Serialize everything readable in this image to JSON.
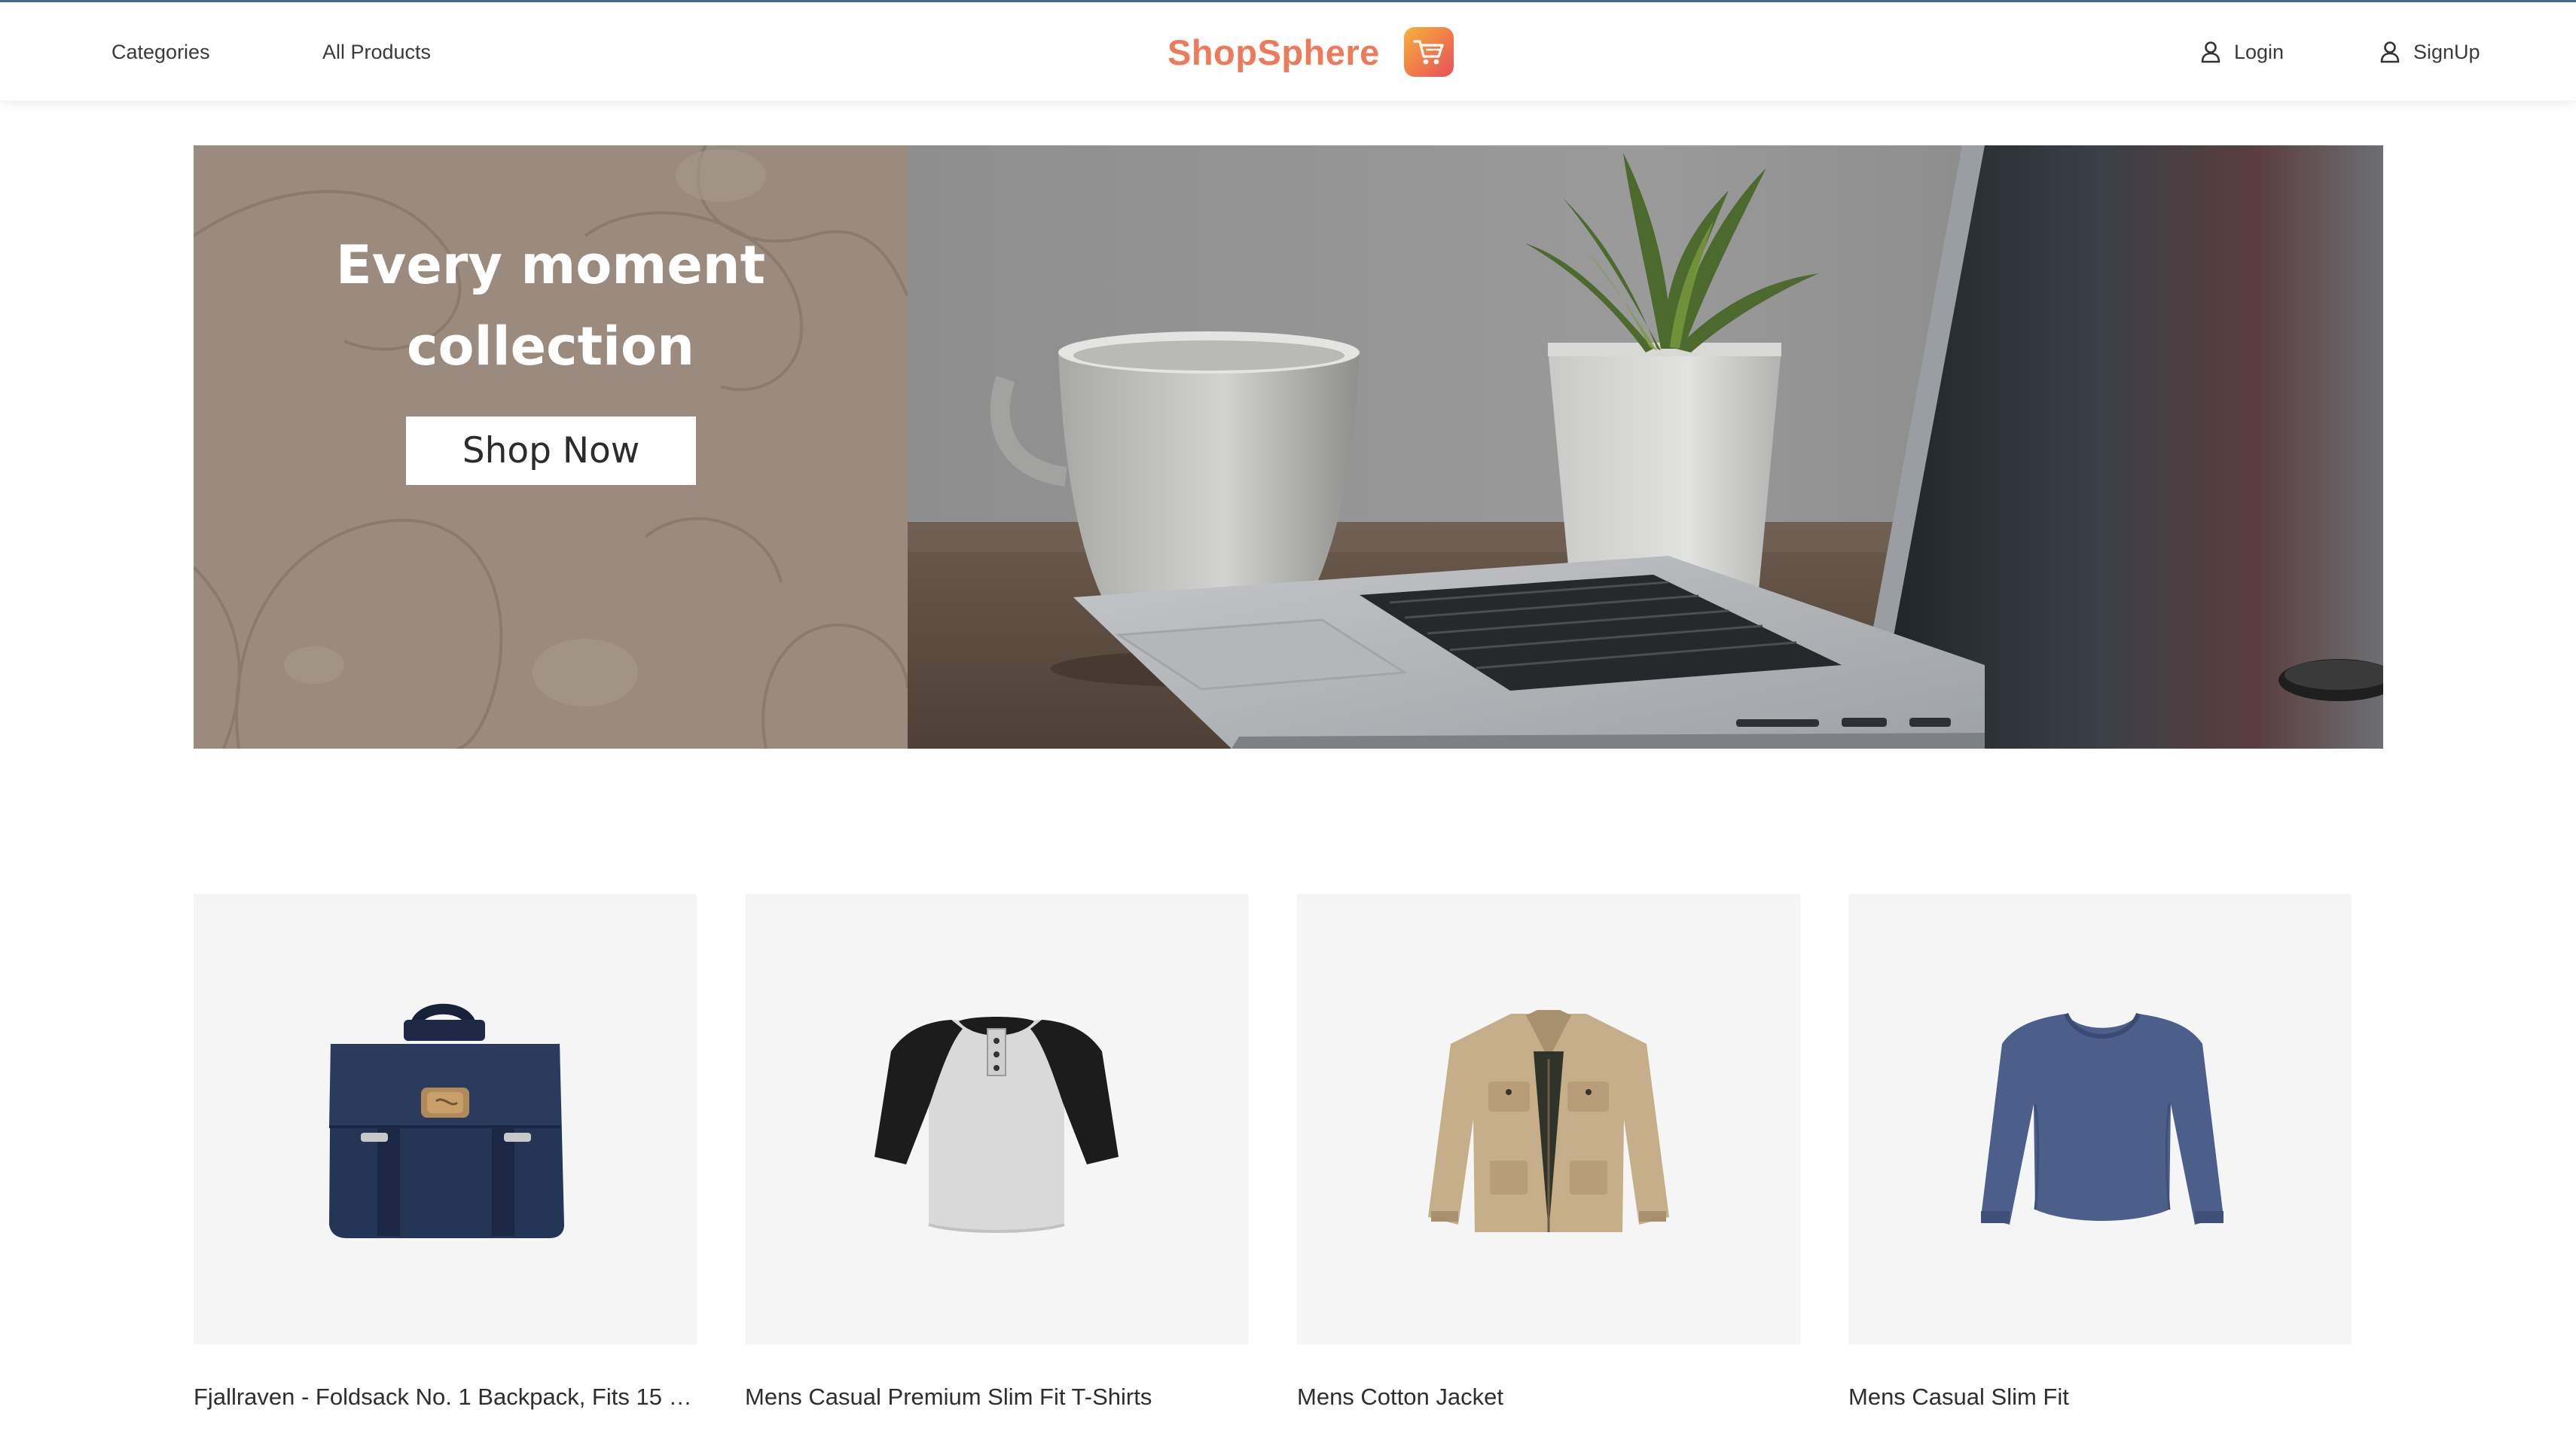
{
  "header": {
    "nav": [
      {
        "label": "Categories"
      },
      {
        "label": "All Products"
      }
    ],
    "brand": {
      "name": "ShopSphere",
      "icon": "shopping-cart-icon"
    },
    "auth": {
      "login_label": "Login",
      "signup_label": "SignUp",
      "icon": "user-icon"
    }
  },
  "hero": {
    "title": "Every moment\ncollection",
    "button_label": "Shop Now"
  },
  "products": [
    {
      "title": "Fjallraven - Foldsack No. 1 Backpack, Fits 15 L...",
      "image": "navy-backpack"
    },
    {
      "title": "Mens Casual Premium Slim Fit T-Shirts",
      "image": "raglan-henley-tshirt"
    },
    {
      "title": "Mens Cotton Jacket",
      "image": "khaki-cotton-jacket"
    },
    {
      "title": "Mens Casual Slim Fit",
      "image": "blue-long-sleeve-shirt"
    }
  ],
  "colors": {
    "brand": "#ee7a5a",
    "hero_panel": "#9a8b7e",
    "card_bg": "#f5f5f5"
  }
}
